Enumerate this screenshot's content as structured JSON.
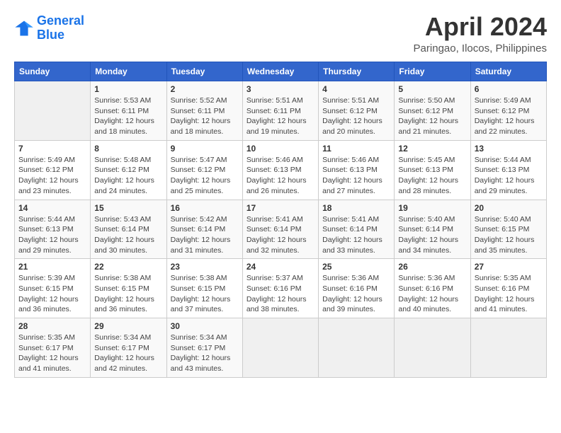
{
  "header": {
    "logo_line1": "General",
    "logo_line2": "Blue",
    "title": "April 2024",
    "subtitle": "Paringao, Ilocos, Philippines"
  },
  "days_of_week": [
    "Sunday",
    "Monday",
    "Tuesday",
    "Wednesday",
    "Thursday",
    "Friday",
    "Saturday"
  ],
  "weeks": [
    [
      {
        "day": "",
        "info": ""
      },
      {
        "day": "1",
        "info": "Sunrise: 5:53 AM\nSunset: 6:11 PM\nDaylight: 12 hours\nand 18 minutes."
      },
      {
        "day": "2",
        "info": "Sunrise: 5:52 AM\nSunset: 6:11 PM\nDaylight: 12 hours\nand 18 minutes."
      },
      {
        "day": "3",
        "info": "Sunrise: 5:51 AM\nSunset: 6:11 PM\nDaylight: 12 hours\nand 19 minutes."
      },
      {
        "day": "4",
        "info": "Sunrise: 5:51 AM\nSunset: 6:12 PM\nDaylight: 12 hours\nand 20 minutes."
      },
      {
        "day": "5",
        "info": "Sunrise: 5:50 AM\nSunset: 6:12 PM\nDaylight: 12 hours\nand 21 minutes."
      },
      {
        "day": "6",
        "info": "Sunrise: 5:49 AM\nSunset: 6:12 PM\nDaylight: 12 hours\nand 22 minutes."
      }
    ],
    [
      {
        "day": "7",
        "info": "Sunrise: 5:49 AM\nSunset: 6:12 PM\nDaylight: 12 hours\nand 23 minutes."
      },
      {
        "day": "8",
        "info": "Sunrise: 5:48 AM\nSunset: 6:12 PM\nDaylight: 12 hours\nand 24 minutes."
      },
      {
        "day": "9",
        "info": "Sunrise: 5:47 AM\nSunset: 6:12 PM\nDaylight: 12 hours\nand 25 minutes."
      },
      {
        "day": "10",
        "info": "Sunrise: 5:46 AM\nSunset: 6:13 PM\nDaylight: 12 hours\nand 26 minutes."
      },
      {
        "day": "11",
        "info": "Sunrise: 5:46 AM\nSunset: 6:13 PM\nDaylight: 12 hours\nand 27 minutes."
      },
      {
        "day": "12",
        "info": "Sunrise: 5:45 AM\nSunset: 6:13 PM\nDaylight: 12 hours\nand 28 minutes."
      },
      {
        "day": "13",
        "info": "Sunrise: 5:44 AM\nSunset: 6:13 PM\nDaylight: 12 hours\nand 29 minutes."
      }
    ],
    [
      {
        "day": "14",
        "info": "Sunrise: 5:44 AM\nSunset: 6:13 PM\nDaylight: 12 hours\nand 29 minutes."
      },
      {
        "day": "15",
        "info": "Sunrise: 5:43 AM\nSunset: 6:14 PM\nDaylight: 12 hours\nand 30 minutes."
      },
      {
        "day": "16",
        "info": "Sunrise: 5:42 AM\nSunset: 6:14 PM\nDaylight: 12 hours\nand 31 minutes."
      },
      {
        "day": "17",
        "info": "Sunrise: 5:41 AM\nSunset: 6:14 PM\nDaylight: 12 hours\nand 32 minutes."
      },
      {
        "day": "18",
        "info": "Sunrise: 5:41 AM\nSunset: 6:14 PM\nDaylight: 12 hours\nand 33 minutes."
      },
      {
        "day": "19",
        "info": "Sunrise: 5:40 AM\nSunset: 6:14 PM\nDaylight: 12 hours\nand 34 minutes."
      },
      {
        "day": "20",
        "info": "Sunrise: 5:40 AM\nSunset: 6:15 PM\nDaylight: 12 hours\nand 35 minutes."
      }
    ],
    [
      {
        "day": "21",
        "info": "Sunrise: 5:39 AM\nSunset: 6:15 PM\nDaylight: 12 hours\nand 36 minutes."
      },
      {
        "day": "22",
        "info": "Sunrise: 5:38 AM\nSunset: 6:15 PM\nDaylight: 12 hours\nand 36 minutes."
      },
      {
        "day": "23",
        "info": "Sunrise: 5:38 AM\nSunset: 6:15 PM\nDaylight: 12 hours\nand 37 minutes."
      },
      {
        "day": "24",
        "info": "Sunrise: 5:37 AM\nSunset: 6:16 PM\nDaylight: 12 hours\nand 38 minutes."
      },
      {
        "day": "25",
        "info": "Sunrise: 5:36 AM\nSunset: 6:16 PM\nDaylight: 12 hours\nand 39 minutes."
      },
      {
        "day": "26",
        "info": "Sunrise: 5:36 AM\nSunset: 6:16 PM\nDaylight: 12 hours\nand 40 minutes."
      },
      {
        "day": "27",
        "info": "Sunrise: 5:35 AM\nSunset: 6:16 PM\nDaylight: 12 hours\nand 41 minutes."
      }
    ],
    [
      {
        "day": "28",
        "info": "Sunrise: 5:35 AM\nSunset: 6:17 PM\nDaylight: 12 hours\nand 41 minutes."
      },
      {
        "day": "29",
        "info": "Sunrise: 5:34 AM\nSunset: 6:17 PM\nDaylight: 12 hours\nand 42 minutes."
      },
      {
        "day": "30",
        "info": "Sunrise: 5:34 AM\nSunset: 6:17 PM\nDaylight: 12 hours\nand 43 minutes."
      },
      {
        "day": "",
        "info": ""
      },
      {
        "day": "",
        "info": ""
      },
      {
        "day": "",
        "info": ""
      },
      {
        "day": "",
        "info": ""
      }
    ]
  ]
}
